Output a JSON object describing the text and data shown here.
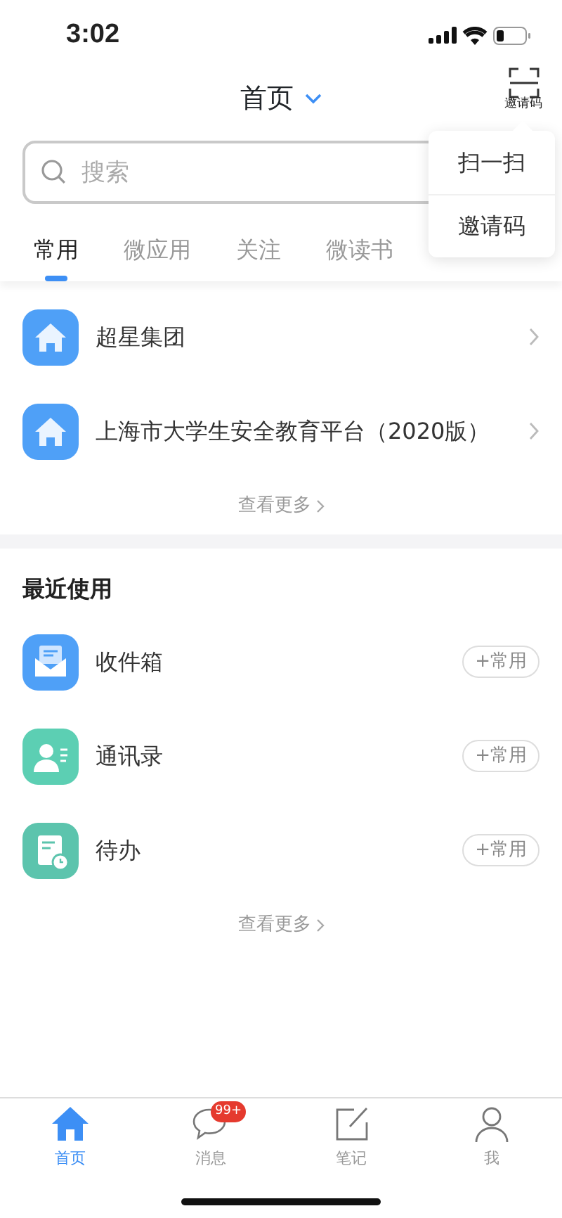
{
  "status_bar": {
    "time": "3:02"
  },
  "header": {
    "title": "首页",
    "scan_label": "邀请码"
  },
  "search": {
    "placeholder": "搜索"
  },
  "tabs": [
    {
      "label": "常用",
      "selected": true
    },
    {
      "label": "微应用",
      "selected": false
    },
    {
      "label": "关注",
      "selected": false
    },
    {
      "label": "微读书",
      "selected": false
    }
  ],
  "popup_menu": [
    "扫一扫",
    "邀请码"
  ],
  "favorites": {
    "items": [
      {
        "name": "超星集团"
      },
      {
        "name": "上海市大学生安全教育平台（2020版）"
      }
    ],
    "more": "查看更多"
  },
  "recent": {
    "title": "最近使用",
    "items": [
      {
        "name": "收件箱",
        "kind": "mail",
        "color": "#4fa0f7",
        "action": "+常用"
      },
      {
        "name": "通讯录",
        "kind": "contacts",
        "color": "#5ccfb3",
        "action": "+常用"
      },
      {
        "name": "待办",
        "kind": "todo",
        "color": "#5cc4ad",
        "action": "+常用"
      }
    ],
    "more": "查看更多"
  },
  "bottom_nav": [
    {
      "label": "首页",
      "kind": "home",
      "selected": true
    },
    {
      "label": "消息",
      "kind": "message",
      "selected": false,
      "badge": "99+"
    },
    {
      "label": "笔记",
      "kind": "note",
      "selected": false
    },
    {
      "label": "我",
      "kind": "me",
      "selected": false
    }
  ]
}
